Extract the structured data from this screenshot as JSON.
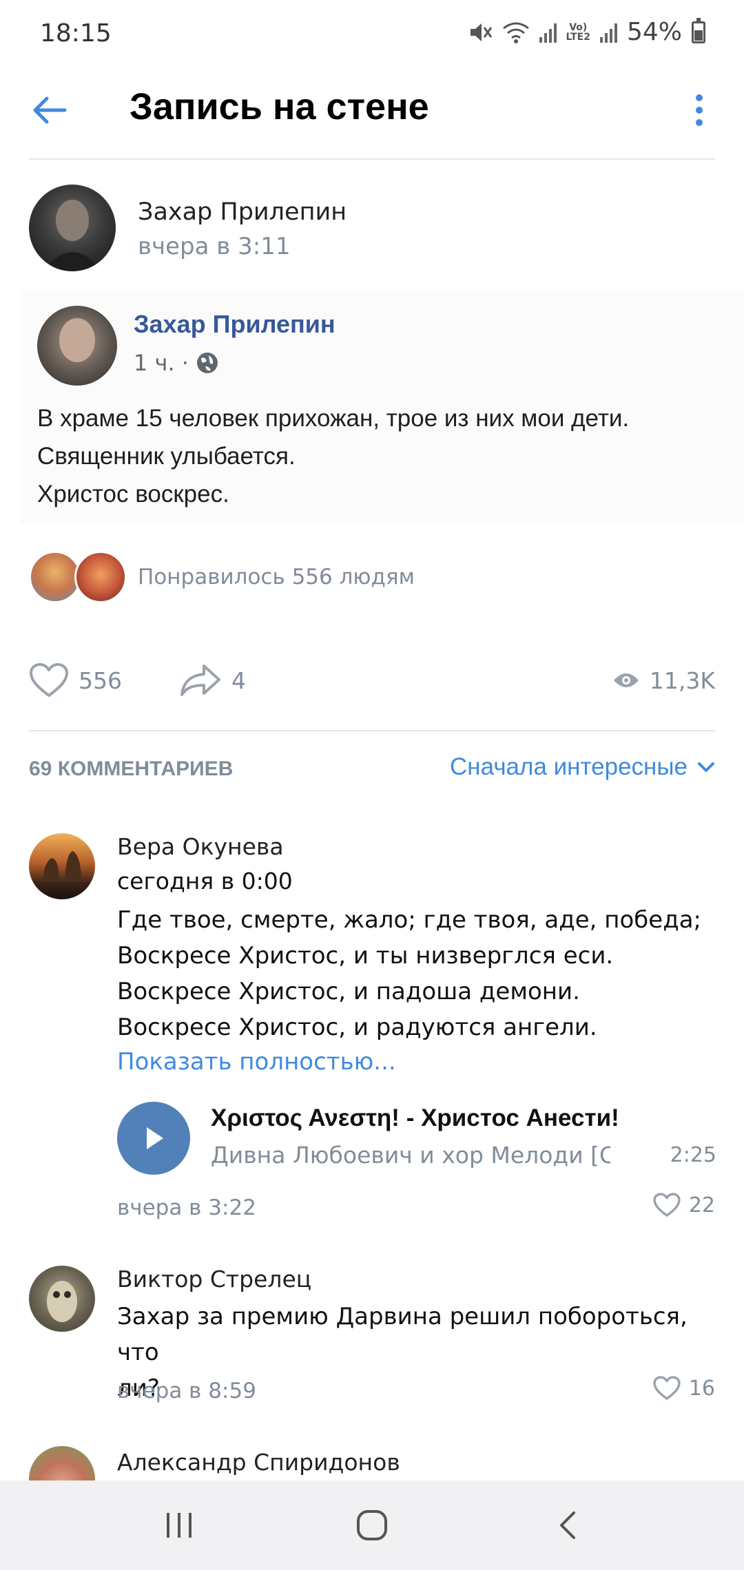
{
  "status_bar": {
    "time": "18:15",
    "battery": "54%",
    "network_label": "Vo) LTE2"
  },
  "header": {
    "title": "Запись на стене",
    "accent": "#3f8ae0"
  },
  "post": {
    "author": "Захар Прилепин",
    "time": "вчера в 3:11",
    "embed": {
      "author": "Захар Прилепин",
      "time": "1 ч. ·",
      "lines": [
        "В храме 15 человек прихожан, трое из них мои дети.",
        "Священник улыбается.",
        "Христос воскрес."
      ]
    },
    "likes_text": "Понравилось 556 людям",
    "like_count": "556",
    "share_count": "4",
    "views": "11,3K"
  },
  "comments_header": {
    "count": "69 КОММЕНТАРИЕВ",
    "sort": "Сначала интересные"
  },
  "comments": [
    {
      "author": "Вера Окунева",
      "time": "сегодня в 0:00",
      "lines": [
        "Где твое, смерте, жало; где твоя, аде, победа;",
        "Воскресе Христос, и ты низверглся еси.",
        "Воскресе Христос, и падоша демони.",
        "Воскресе Христос, и радуются ангели."
      ],
      "show_more": "Показать полностью...",
      "audio": {
        "title": "Χριστος Ανεστη! - Христос Анести!",
        "artist": "Дивна Любоевич и хор Мелоди [Се...",
        "duration": "2:25"
      },
      "date": "вчера в 3:22",
      "likes": "22"
    },
    {
      "author": "Виктор Стрелец",
      "lines": [
        "Захар за премию Дарвина решил побороться, что",
        "ли?"
      ],
      "date": "вчера в 8:59",
      "likes": "16"
    },
    {
      "author": "Александр Спиридонов"
    }
  ]
}
